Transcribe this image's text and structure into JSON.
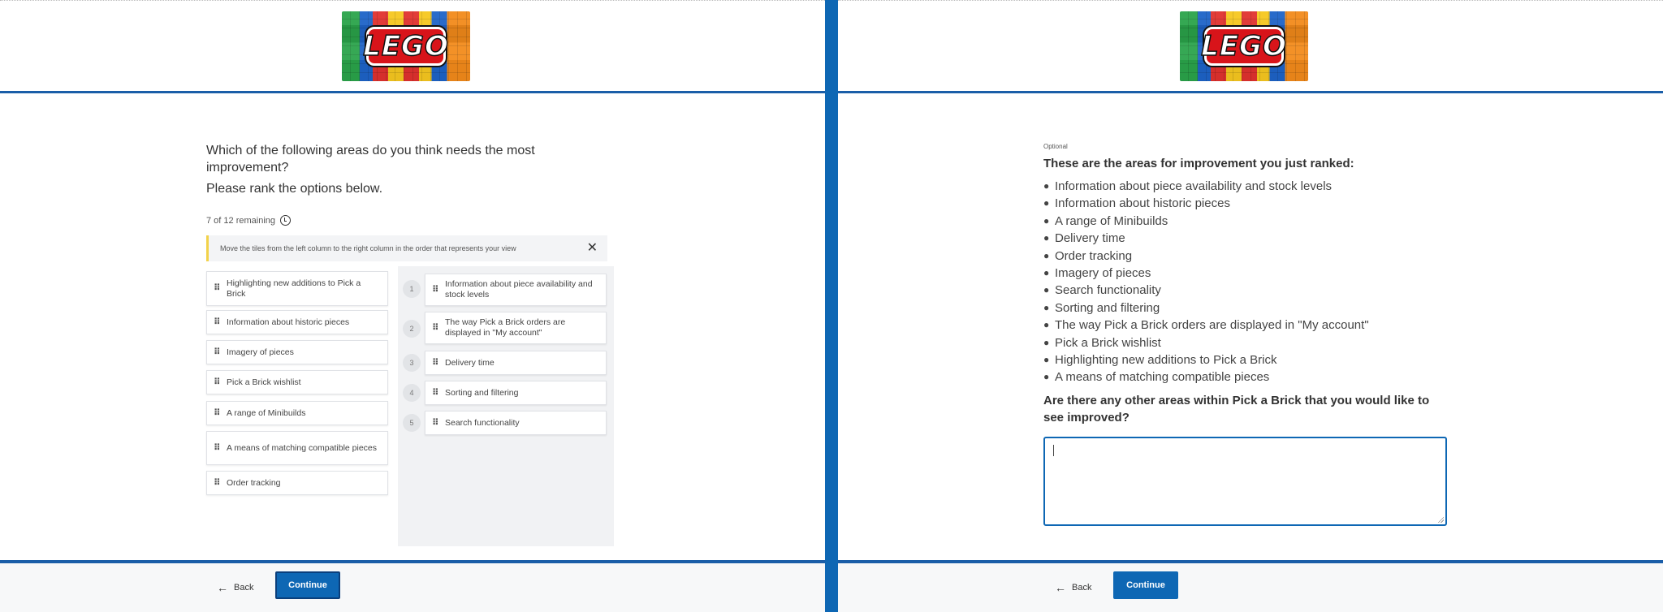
{
  "brand": {
    "logo_text": "LEGO"
  },
  "left": {
    "question": "Which of the following areas do you think needs the most improvement?",
    "instruction": "Please rank the options below.",
    "remaining": "7 of 12 remaining",
    "hint": "Move the tiles from the left column to the right column in the order that represents your view",
    "unranked": [
      "Highlighting new additions to Pick a Brick",
      "Information about historic pieces",
      "Imagery of pieces",
      "Pick a Brick wishlist",
      "A range of Minibuilds",
      "A means of matching compatible pieces",
      "Order tracking"
    ],
    "ranked": [
      {
        "rank": "1",
        "label": "Information about piece availability and stock levels"
      },
      {
        "rank": "2",
        "label": "The way Pick a Brick orders are displayed in \"My account\""
      },
      {
        "rank": "3",
        "label": "Delivery time"
      },
      {
        "rank": "4",
        "label": "Sorting and filtering"
      },
      {
        "rank": "5",
        "label": "Search functionality"
      }
    ]
  },
  "right": {
    "optional": "Optional",
    "ranked_title": "These are the areas for improvement you just ranked:",
    "ranked_list": [
      "Information about piece availability and stock levels",
      "Information about historic pieces",
      "A range of Minibuilds",
      "Delivery time",
      "Order tracking",
      "Imagery of pieces",
      "Search functionality",
      "Sorting and filtering",
      "The way Pick a Brick orders are displayed in \"My account\"",
      "Pick a Brick wishlist",
      "Highlighting new additions to Pick a Brick",
      "A means of matching compatible pieces"
    ],
    "other_question": "Are there any other areas within Pick a Brick that you would like to see improved?",
    "textbox_value": ""
  },
  "footer": {
    "back_label": "Back",
    "continue_label": "Continue"
  },
  "icons": {
    "drag": "drag-handle-icon",
    "close": "close-icon",
    "info": "info-icon",
    "back": "arrow-left-icon"
  },
  "colors": {
    "accent": "#0e67b4",
    "hint_border": "#f2d24a"
  }
}
